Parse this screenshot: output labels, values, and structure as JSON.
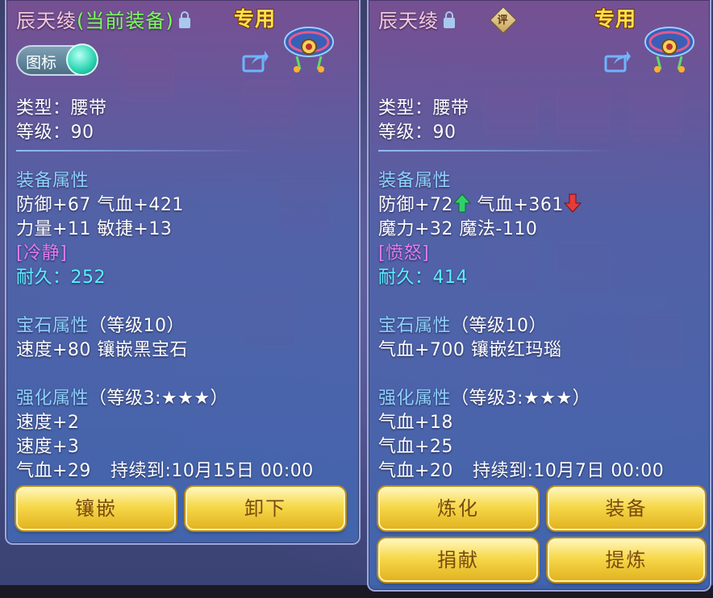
{
  "left_panel": {
    "title": "辰天绫",
    "equipped_tag": "(当前装备)",
    "special_tag": "专用",
    "toggle_label": "图标",
    "type_line": "类型：腰带",
    "level_line": "等级：90",
    "attr_header": "装备属性",
    "attr_lines": [
      "防御+67 气血+421",
      "力量+11 敏捷+13"
    ],
    "trait": "[冷静]",
    "durability_label": "耐久：",
    "durability_value": "252",
    "gem_header": "宝石属性",
    "gem_level": "（等级10）",
    "gem_line": "速度+80 镶嵌黑宝石",
    "enhance_header": "强化属性",
    "enhance_level": "（等级3:★★★）",
    "enhance_lines": [
      "速度+2",
      "速度+3"
    ],
    "enhance_last": "气血+29",
    "duration": "持续到:10月15日 00:00",
    "buttons": [
      "镶嵌",
      "卸下"
    ]
  },
  "right_panel": {
    "title": "辰天绫",
    "eval_badge": "评",
    "special_tag": "专用",
    "type_line": "类型：腰带",
    "level_line": "等级：90",
    "attr_header": "装备属性",
    "attr_line1_a": "防御+72",
    "attr_line1_b": "气血+361",
    "attr_line2": "魔力+32 魔法-110",
    "trait": "[愤怒]",
    "durability_label": "耐久：",
    "durability_value": "414",
    "gem_header": "宝石属性",
    "gem_level": "（等级10）",
    "gem_line": "气血+700 镶嵌红玛瑙",
    "enhance_header": "强化属性",
    "enhance_level": "（等级3:★★★）",
    "enhance_lines": [
      "气血+18",
      "气血+25"
    ],
    "enhance_last": "气血+20",
    "duration": "持续到:10月7日 00:00",
    "buttons": [
      "炼化",
      "装备",
      "捐献",
      "提炼"
    ]
  },
  "colors": {
    "text": "#ffffff",
    "section_header": "#8fd2ff",
    "trait": "#e37cf4",
    "durability": "#5cf0ff",
    "equipped_tag": "#7cff5c",
    "special_tag": "#ffe14a",
    "button_text": "#7a4a10",
    "arrow_up": "#2fd06a",
    "arrow_down": "#e83a3a"
  },
  "icons": [
    "lock-icon",
    "share-icon",
    "belt-item-icon",
    "evaluate-badge-icon",
    "arrow-up-icon",
    "arrow-down-icon"
  ]
}
